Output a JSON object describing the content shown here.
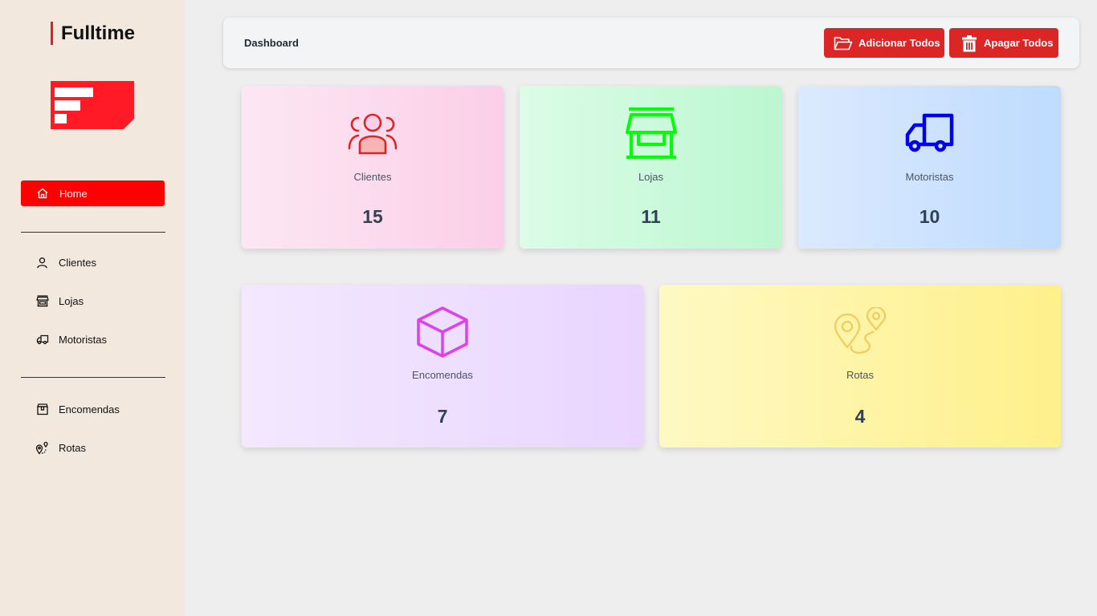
{
  "app": {
    "brand": "Fulltime"
  },
  "sidebar": {
    "home": {
      "label": "Home",
      "icon": "home-icon"
    },
    "items": [
      {
        "label": "Clientes",
        "icon": "user-icon"
      },
      {
        "label": "Lojas",
        "icon": "store-icon"
      },
      {
        "label": "Motoristas",
        "icon": "truck-icon"
      },
      {
        "label": "Encomendas",
        "icon": "package-icon"
      },
      {
        "label": "Rotas",
        "icon": "route-icon"
      }
    ]
  },
  "header": {
    "title": "Dashboard",
    "add_all_label": "Adicionar Todos",
    "delete_all_label": "Apagar Todos"
  },
  "cards": [
    {
      "label": "Clientes",
      "value": "15",
      "icon": "users-icon",
      "icon_color": "#dc2626"
    },
    {
      "label": "Lojas",
      "value": "11",
      "icon": "store-icon",
      "icon_color": "#00ff00"
    },
    {
      "label": "Motoristas",
      "value": "10",
      "icon": "truck-icon",
      "icon_color": "#0000ee"
    },
    {
      "label": "Encomendas",
      "value": "7",
      "icon": "box-icon",
      "icon_color": "#e040e8"
    },
    {
      "label": "Rotas",
      "value": "4",
      "icon": "map-pin-route-icon",
      "icon_color": "#f5c95c"
    }
  ],
  "colors": {
    "accent": "#ff0000",
    "button": "#dc2626",
    "sidebar_bg": "#f3e8de"
  }
}
